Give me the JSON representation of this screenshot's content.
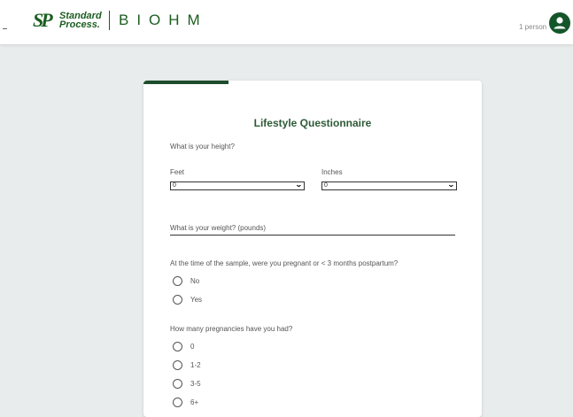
{
  "header": {
    "brand_line1": "Standard",
    "brand_line2": "Process.",
    "brand_mark": "SP",
    "product": "BIOHM",
    "person_label": "1 person",
    "avatar_icon": "user-icon"
  },
  "form": {
    "progress_fraction": 0.25,
    "title": "Lifestyle Questionnaire",
    "height_question": "What is your height?",
    "feet_label": "Feet",
    "feet_value": "0",
    "inches_label": "Inches",
    "inches_value": "0",
    "weight_placeholder": "What is your weight? (pounds)",
    "pregnant_question": "At the time of the sample, were you pregnant or < 3 months postpartum?",
    "pregnant_options": [
      "No",
      "Yes"
    ],
    "pregnancies_question": "How many pregnancies have you had?",
    "pregnancies_options": [
      "0",
      "1-2",
      "3-5",
      "6+"
    ]
  },
  "colors": {
    "brand_green": "#1b5e20",
    "progress": "#1e4d2b",
    "background": "#e9ecec"
  }
}
